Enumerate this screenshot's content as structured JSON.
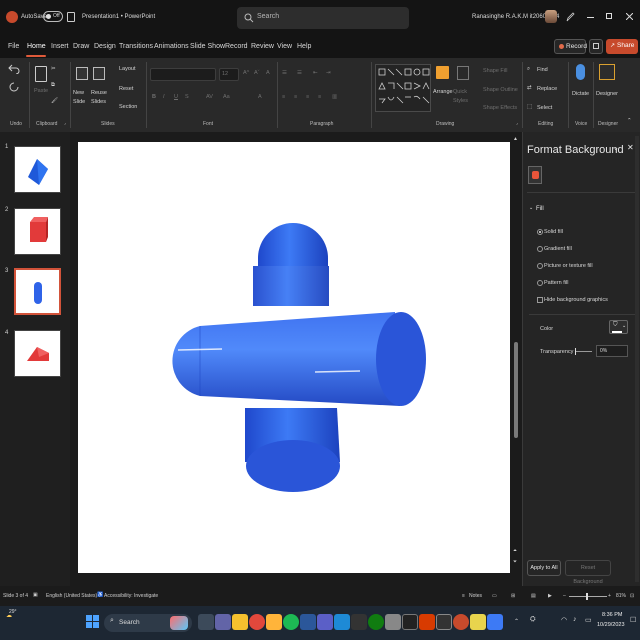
{
  "titlebar": {
    "autosave_label": "AutoSave",
    "autosave_state": "Off",
    "doc_title": "Presentation1 • PowerPoint",
    "search_placeholder": "Search",
    "user_name": "Ranasinghe R.A.K.M it20609884"
  },
  "menu": {
    "items": [
      "File",
      "Home",
      "Insert",
      "Draw",
      "Design",
      "Transitions",
      "Animations",
      "Slide Show",
      "Record",
      "Review",
      "View",
      "Help"
    ],
    "active": "Home",
    "record_label": "Record",
    "share_label": "Share"
  },
  "ribbon": {
    "groups": [
      "Undo",
      "Clipboard",
      "Slides",
      "Font",
      "Paragraph",
      "Drawing",
      "Editing",
      "Voice",
      "Designer"
    ],
    "clipboard": {
      "paste": "Paste"
    },
    "slides": {
      "new_slide": "New Slide",
      "reuse_slides": "Reuse Slides",
      "layout": "Layout",
      "reset": "Reset",
      "section": "Section"
    },
    "font": {
      "size": "12"
    },
    "drawing": {
      "arrange": "Arrange",
      "quick_styles": "Quick Styles",
      "shape_fill": "Shape Fill",
      "shape_outline": "Shape Outline",
      "shape_effects": "Shape Effects"
    },
    "editing": {
      "find": "Find",
      "replace": "Replace",
      "select": "Select"
    },
    "voice": {
      "dictate": "Dictate"
    },
    "designer": {
      "designer": "Designer"
    }
  },
  "slides_panel": {
    "numbers": [
      "1",
      "2",
      "3",
      "4"
    ],
    "selected_index": 3
  },
  "format_pane": {
    "title": "Format Background",
    "section": "Fill",
    "options": [
      "Solid fill",
      "Gradient fill",
      "Picture or texture fill",
      "Pattern fill"
    ],
    "selected_option": "Solid fill",
    "hide_bg": "Hide background graphics",
    "color_label": "Color",
    "transparency_label": "Transparency",
    "transparency_value": "0%",
    "apply_all": "Apply to All",
    "reset_bg": "Reset Background"
  },
  "statusbar": {
    "slide_info": "Slide 3 of 4",
    "language": "English (United States)",
    "accessibility": "Accessibility: Investigate",
    "notes": "Notes",
    "zoom": "81%"
  },
  "taskbar": {
    "weather": "29°",
    "search": "Search",
    "time": "8:36 PM",
    "date": "10/29/2023"
  },
  "colors": {
    "accent": "#c74a2c",
    "shape_blue": "#2f63e8",
    "shape_blue_dark": "#1d44c2"
  }
}
